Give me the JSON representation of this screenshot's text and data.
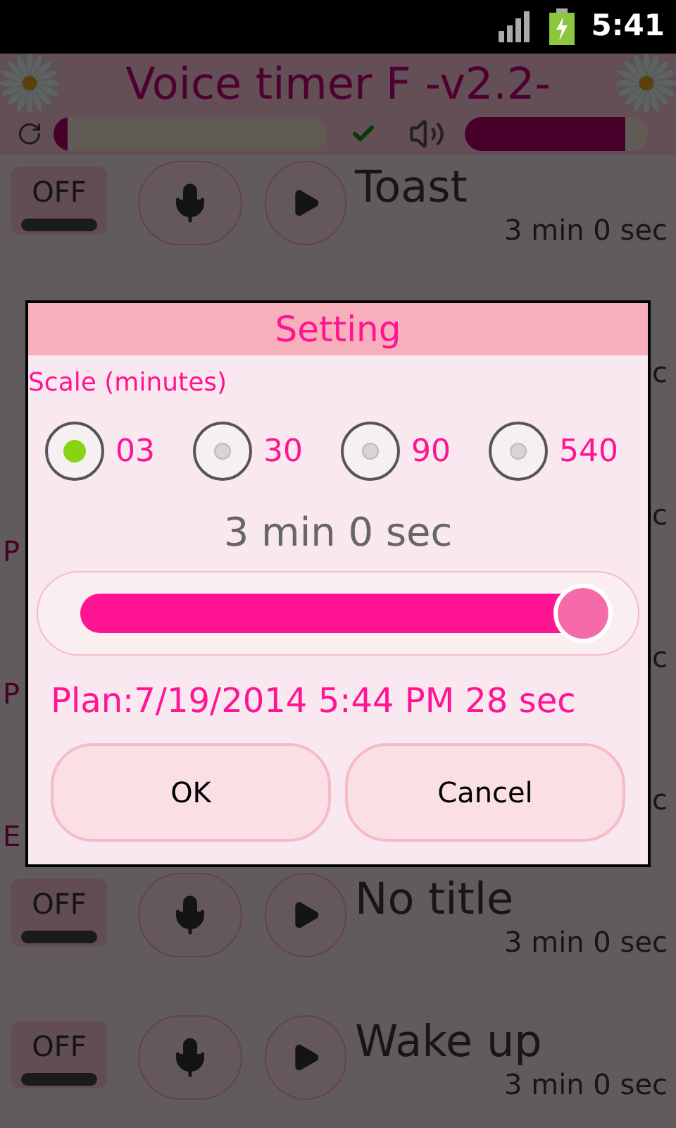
{
  "status_bar": {
    "time": "5:41"
  },
  "header": {
    "title": "Voice timer F -v2.2-",
    "progress": {
      "level": 0.05
    },
    "check_shown": true,
    "volume": {
      "level": 0.88
    }
  },
  "rows": [
    {
      "kind": "timer",
      "toggle": "OFF",
      "title": "Toast",
      "duration": "3 min 0 sec"
    },
    {
      "kind": "hidden",
      "duration": "c"
    },
    {
      "kind": "hidden",
      "duration": "c",
      "note": "P"
    },
    {
      "kind": "hidden",
      "duration": "c",
      "note": "P"
    },
    {
      "kind": "hidden",
      "duration": "c",
      "note": "E"
    },
    {
      "kind": "timer",
      "toggle": "OFF",
      "title": "No title",
      "duration": "3 min 0 sec"
    },
    {
      "kind": "timer",
      "toggle": "OFF",
      "title": "Wake up",
      "duration": "3 min 0 sec"
    }
  ],
  "dialog": {
    "title": "Setting",
    "scale_label": "Scale (minutes)",
    "scales": [
      {
        "label": "03",
        "selected": true
      },
      {
        "label": "30",
        "selected": false
      },
      {
        "label": "90",
        "selected": false
      },
      {
        "label": "540",
        "selected": false
      }
    ],
    "duration": "3 min 0 sec",
    "slider": {
      "level": 1.0
    },
    "plan": "Plan:7/19/2014 5:44 PM 28 sec",
    "buttons": [
      "OK",
      "Cancel"
    ]
  }
}
